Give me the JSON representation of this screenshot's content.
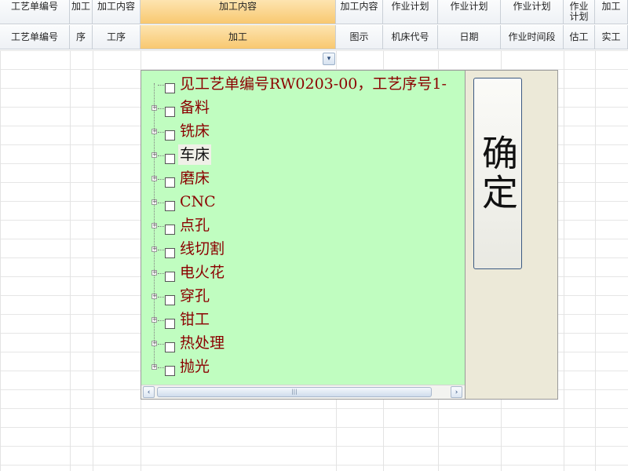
{
  "header": {
    "row1": [
      "工艺单编号",
      "加工",
      "加工内容",
      "加工内容",
      "加工内容",
      "作业计划",
      "作业计划",
      "作业计划",
      "作业计划",
      "加工"
    ],
    "row2": [
      "工艺单编号",
      "序",
      "工序",
      "加工",
      "图示",
      "机床代号",
      "日期",
      "作业时间段",
      "估工",
      "实工"
    ]
  },
  "tree": {
    "root_label": "见工艺单编号RW0203-00，工艺序号1-",
    "items": [
      "备料",
      "铣床",
      "车床",
      "磨床",
      "CNC",
      "点孔",
      "线切割",
      "电火花",
      "穿孔",
      "钳工",
      "热处理",
      "抛光"
    ],
    "selected_index": 2,
    "expander_symbol": "+",
    "scroll_grip": "|||"
  },
  "confirm_label": "确定",
  "dropdown_arrow": "▾",
  "scroll_left": "‹",
  "scroll_right": "›"
}
